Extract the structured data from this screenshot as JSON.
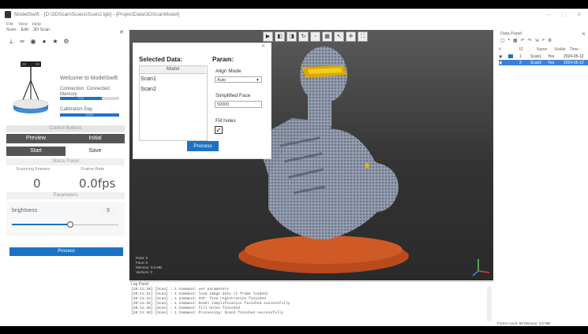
{
  "window": {
    "title": "ModelSwift - [D:\\3DScan\\Scans\\Scan2.lgb] - [ProjectData\\3DScanModel]"
  },
  "left_panel": {
    "menu": [
      "File",
      "View",
      "Help"
    ],
    "tabs": [
      "Scan",
      "Edit",
      "3D Scan"
    ],
    "welcome": "Welcome to ModelSwift",
    "connection": "Connection: Connected",
    "camera": "Camera: Connected",
    "memory_label": "Memory",
    "memory_fraction": 0.7,
    "memory_bar_text": "70%",
    "calibration_label": "Calibration Day",
    "calibration_fraction": 1.0,
    "calibration_bar_text": "100%",
    "control_header": "Control Buttons",
    "btn_preview": "Preview",
    "btn_initial": "Initial",
    "btn_start": "Start",
    "btn_save": "Save",
    "status_header": "Status Panel",
    "scanning_frames_label": "Scanning Frames",
    "scanning_frames_value": "0",
    "frame_rate_label": "Frame Rate",
    "frame_rate_value": "0.0fps",
    "parameters_header": "Parameters",
    "brightness_label": "brightness",
    "brightness_value": "9",
    "brightness_fraction": 0.55,
    "btn_process": "Process"
  },
  "dialog": {
    "selected_label": "Selected Data:",
    "list_header": "Model",
    "items": [
      "Scan1",
      "Scan2"
    ],
    "param_label": "Param:",
    "align_mode_label": "Align Mode",
    "align_mode_value": "Auto",
    "simplified_label": "Simplified Face",
    "simplified_value": "50000",
    "fill_holes_label": "Fill holes",
    "fill_holes_checked": true,
    "btn_process": "Process"
  },
  "viewport": {
    "info": [
      "Point: 0",
      "Face: 0",
      "Memory: 3.5 MB",
      "Vertices: 0"
    ]
  },
  "log": {
    "title": "Log Panel",
    "lines": [
      "[20:11:30] [Scan] : 1 Command: set parameters",
      "[20:11:31] [Scan] : 1 Command: load image data (1 frame loaded)",
      "[20:11:33] [Scan] : 1 Command: ICP: fine registration finished",
      "[20:11:35] [Scan] : 1 Command: Model simplification finished successfully",
      "[20:11:38] [Scan] : 1 Command: fill holes finished",
      "[20:11:40] [Scan] : 1 Command: Processing: Scan2 finished successfully"
    ]
  },
  "right_panel": {
    "title": "Data Panel",
    "columns": [
      "#",
      "ID",
      "Name",
      "Visible",
      "Time"
    ],
    "rows": [
      {
        "id": "1",
        "name": "Scan1",
        "visible": "Yes",
        "time": "2024-05-12"
      },
      {
        "id": "2",
        "name": "Scan2",
        "visible": "Yes",
        "time": "2024-05-12"
      }
    ],
    "footer": "Frame count: 58   Memory: 3.5 MB"
  },
  "colors": {
    "accent": "#1a73c7",
    "dark_button": "#555555",
    "model_gray": "#8a94a6",
    "model_base": "#c4511f",
    "highlight": "#e5b500"
  }
}
